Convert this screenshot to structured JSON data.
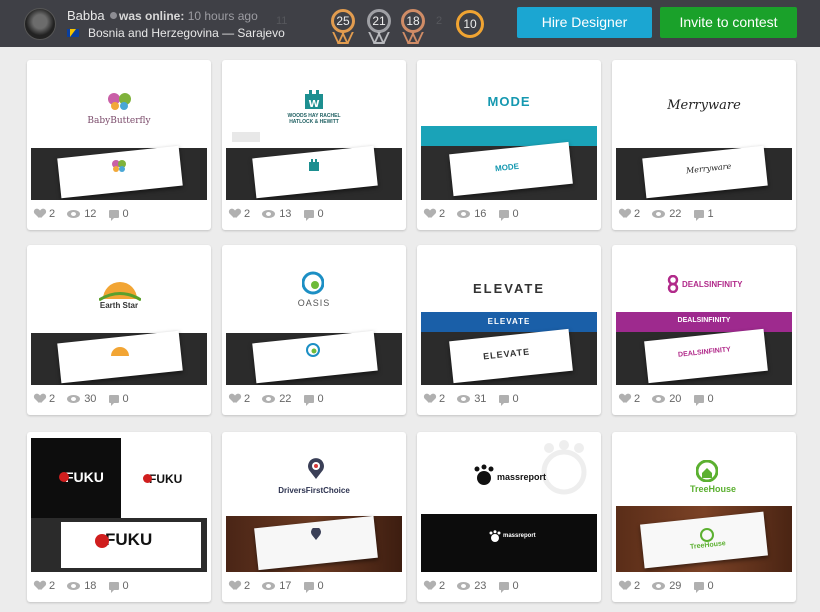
{
  "profile": {
    "username": "Babba",
    "status_label": "was online:",
    "status_time": "10 hours ago",
    "location": "Bosnia and Herzegovina — Sarajevo",
    "ghost_stats": "11",
    "ghost_stats_2": "2"
  },
  "badges": [
    {
      "value": "25",
      "tier": "gold"
    },
    {
      "value": "21",
      "tier": "silver"
    },
    {
      "value": "18",
      "tier": "bronze"
    },
    {
      "value": "10",
      "tier": "circle"
    }
  ],
  "actions": {
    "hire_label": "Hire Designer",
    "invite_label": "Invite to contest"
  },
  "colors": {
    "header_bg": "#3f4046",
    "hire_button": "#1ba6d2",
    "invite_button": "#1aa12a",
    "badge_gold": "#e29c4f",
    "badge_circle": "#f0a432"
  },
  "icons": {
    "likes": "heart-icon",
    "views": "eye-icon",
    "comments": "comment-icon"
  },
  "portfolio": [
    {
      "logo": "BabyButterfly",
      "likes": "2",
      "views": "12",
      "comments": "0"
    },
    {
      "logo": "WOODS HAY RACHEL HATLOCK & HEWITT",
      "likes": "2",
      "views": "13",
      "comments": "0"
    },
    {
      "logo": "MODE",
      "likes": "2",
      "views": "16",
      "comments": "0"
    },
    {
      "logo": "Merryware",
      "likes": "2",
      "views": "22",
      "comments": "1"
    },
    {
      "logo": "Earth Star",
      "likes": "2",
      "views": "30",
      "comments": "0"
    },
    {
      "logo": "OASIS",
      "likes": "2",
      "views": "22",
      "comments": "0"
    },
    {
      "logo": "ELEVATE",
      "likes": "2",
      "views": "31",
      "comments": "0"
    },
    {
      "logo": "DEALSINFINITY",
      "likes": "2",
      "views": "20",
      "comments": "0"
    },
    {
      "logo": "FUKU",
      "likes": "2",
      "views": "18",
      "comments": "0"
    },
    {
      "logo": "DriversFirstChoice",
      "likes": "2",
      "views": "17",
      "comments": "0"
    },
    {
      "logo": "massreport",
      "likes": "2",
      "views": "23",
      "comments": "0"
    },
    {
      "logo": "TreeHouse",
      "likes": "2",
      "views": "29",
      "comments": "0"
    }
  ]
}
